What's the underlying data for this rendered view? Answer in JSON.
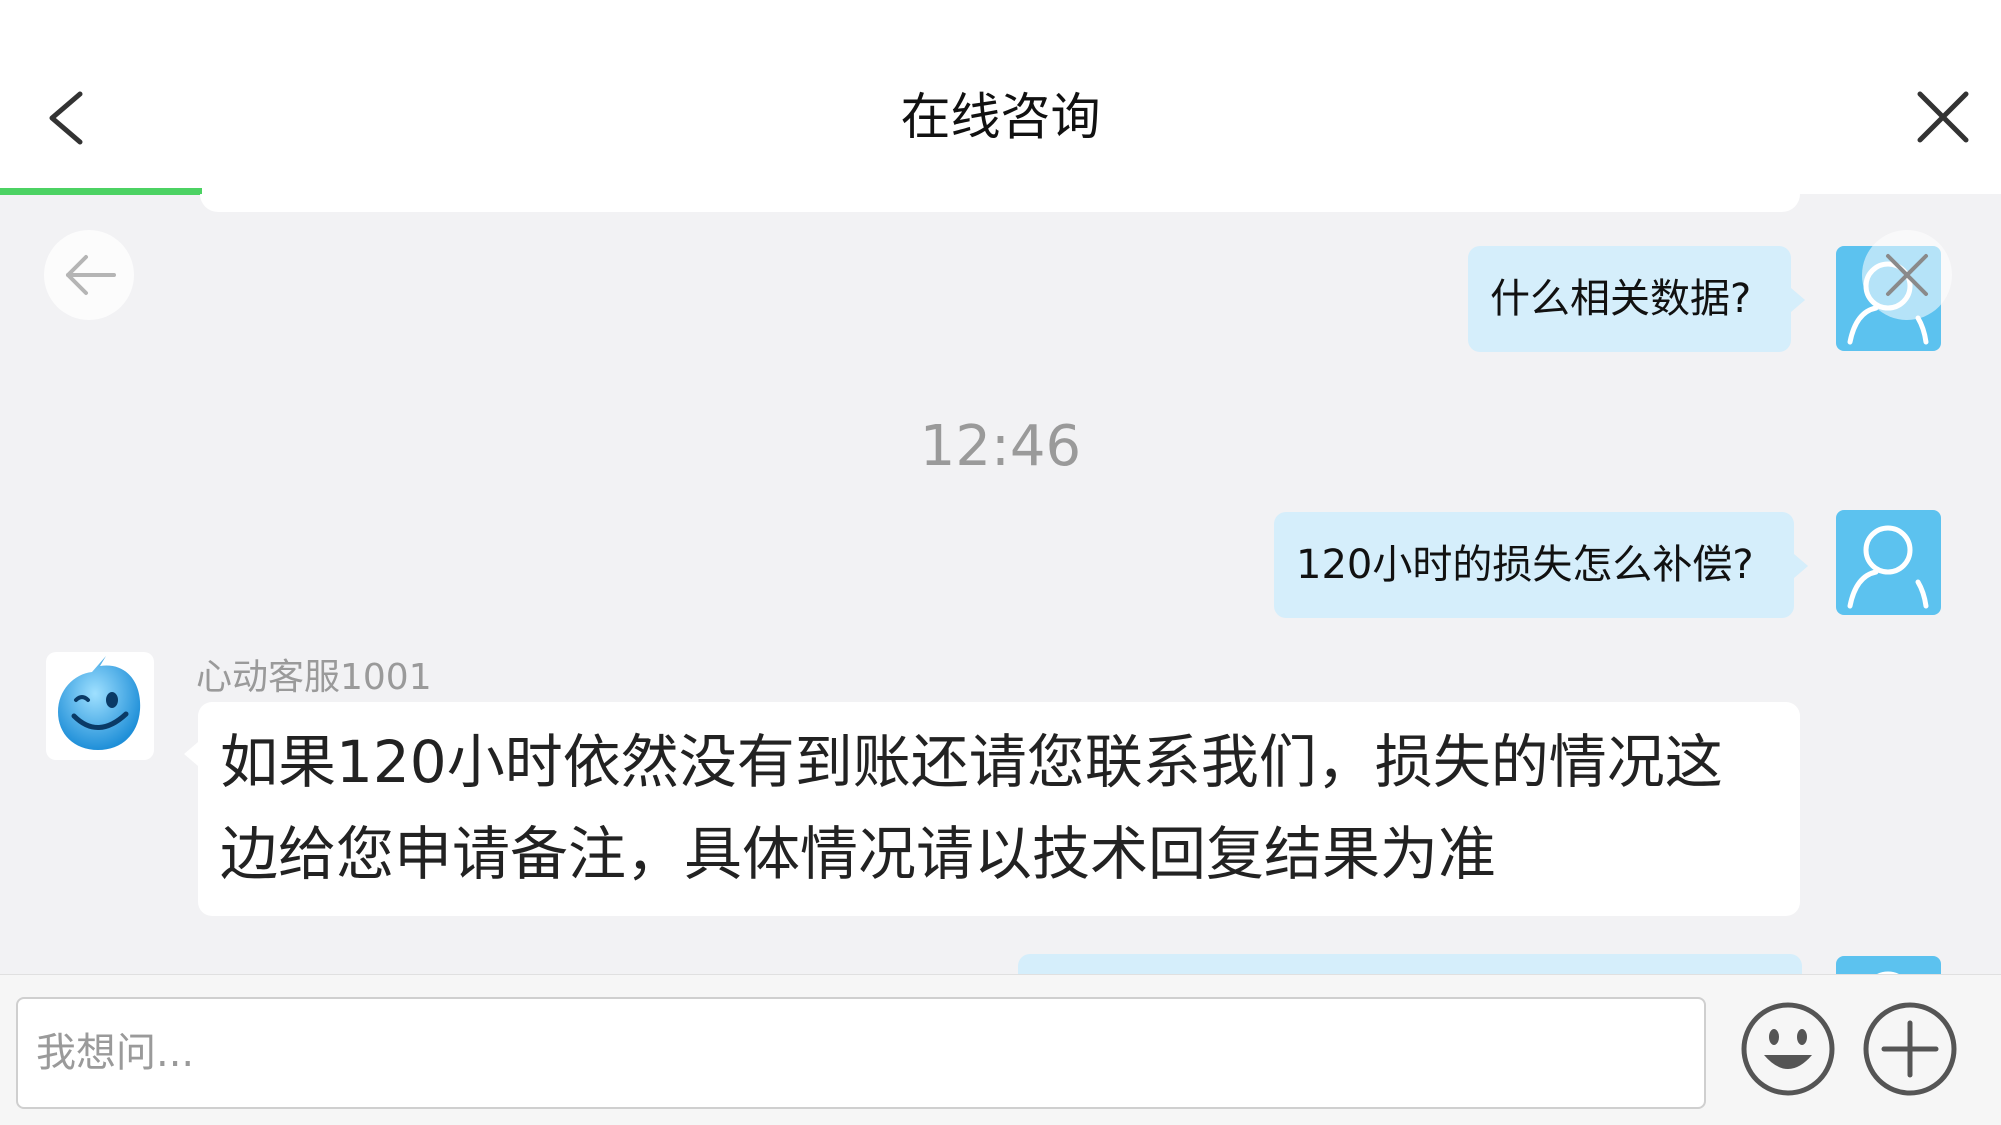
{
  "header": {
    "title": "在线咨询",
    "back_icon": "chevron-left-icon",
    "close_icon": "close-icon",
    "progress_color": "#4cd263"
  },
  "chat": {
    "messages_out_1": {
      "text": "什么相关数据?"
    },
    "timestamp": "12:46",
    "messages_out_2": {
      "text": "120小时的损失怎么补偿?"
    },
    "agent_message": {
      "sender": "心动客服1001",
      "line1": "如果120小时依然没有到账还请您联系我们，损失的情况这",
      "line2": "边给您申请备注，具体情况请以技术回复结果为准"
    },
    "outgoing_bubble_color": "#d5eefb",
    "incoming_bubble_color": "#ffffff"
  },
  "input": {
    "placeholder": "我想问...",
    "value": ""
  },
  "icons": {
    "emoji": "smiley-icon",
    "plus": "plus-circle-icon",
    "float_back": "arrow-left-icon",
    "float_close": "close-icon",
    "user_avatar": "user-avatar-icon",
    "agent_avatar": "agent-avatar-icon"
  }
}
